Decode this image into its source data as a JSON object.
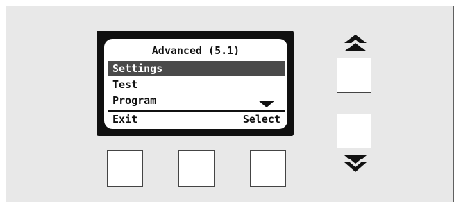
{
  "display": {
    "title": "Advanced (5.1)",
    "menu_items": [
      {
        "label": "Settings",
        "selected": true
      },
      {
        "label": "Test",
        "selected": false
      },
      {
        "label": "Program",
        "selected": false
      }
    ],
    "softkeys": {
      "left": "Exit",
      "right": "Select"
    }
  },
  "icons": {
    "up": "double-chevron-up-icon",
    "down": "double-chevron-down-icon",
    "more_below": "triangle-down-icon"
  },
  "colors": {
    "panel": "#e8e8e8",
    "bezel": "#101010",
    "highlight": "#4a4a4a",
    "text": "#111111"
  }
}
